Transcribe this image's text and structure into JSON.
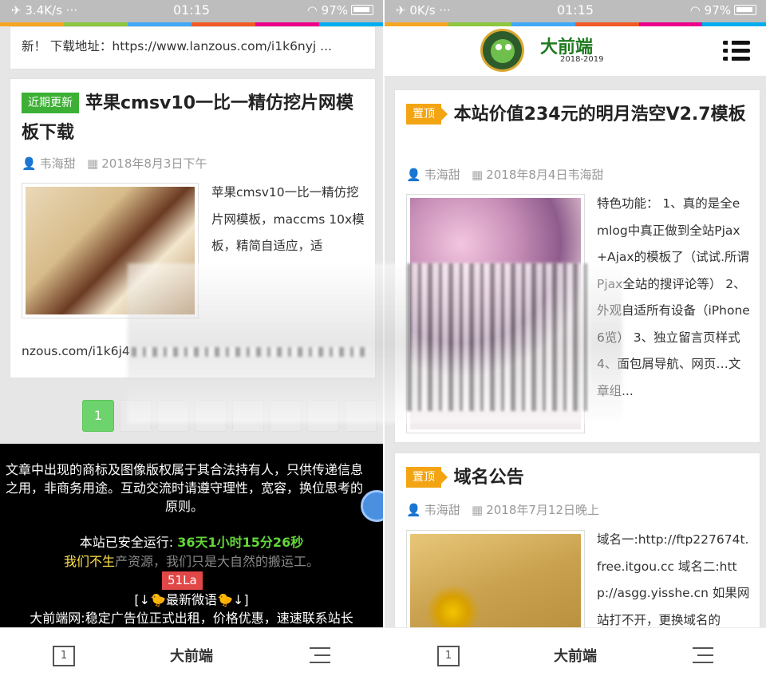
{
  "left": {
    "status": {
      "net": "3.4K/s ···",
      "time": "01:15",
      "battery": "97%"
    },
    "top_card_text": "新！ 下载地址：https://www.lanzous.com/i1k6nyj ...",
    "post": {
      "tag": "近期更新",
      "title": "苹果cmsv10一比一精仿挖片网模板下载",
      "author": "韦海甜",
      "date": "2018年8月3日下午",
      "excerpt": "苹果cmsv10一比一精仿挖片网模板，maccms 10x模板，精简自适应，适",
      "link_fragment": "nzous.com/i1k6j4"
    },
    "pagination": {
      "current": "1"
    },
    "footer": {
      "line1": "文章中出现的商标及图像版权属于其合法持有人，只供传递信息之用，非商务用途。互动交流时请遵守理性，宽容，换位思考的原则。",
      "uptime_label": "本站已安全运行: ",
      "uptime_value": "36天1小时15分26秒",
      "slogan_yellow": "我们不生",
      "slogan_rest": "产资源，我们只是大自然的搬运工。",
      "badge": "51La",
      "weibo": "[↓🐤最新微语🐤↓]",
      "ad": "大前端网:稳定广告位正式出租，价格优惠，速速联系站长"
    },
    "bottom": {
      "tab_count": "1",
      "site_name": "大前端"
    }
  },
  "right": {
    "status": {
      "net": "0K/s ···",
      "time": "01:15",
      "battery": "97%"
    },
    "logo": {
      "name": "大前端",
      "years": "2018-2019"
    },
    "posts": [
      {
        "tag": "置顶",
        "title": "本站价值234元的明月浩空V2.7模板",
        "author": "韦海甜",
        "date": "2018年8月4日韦海甜",
        "excerpt": "特色功能： 1、真的是全emlog中真正做到全站Pjax+Ajax的模板了（试试.所谓Pjax全站的搜评论等） 2、外观自适所有设备（iPhone6览） 3、独立留言页样式 4、面包屑导航、网页…文章组..."
      },
      {
        "tag": "置顶",
        "title": "域名公告",
        "author": "韦海甜",
        "date": "2018年7月12日晚上",
        "excerpt": "域名一:http://ftp227674t.free.itgou.cc 域名二:http://asgg.yisshe.cn 如果网站打不开，更换域名的"
      }
    ],
    "bottom": {
      "tab_count": "1",
      "site_name": "大前端"
    }
  },
  "colors": {
    "rainbow": [
      "#f5a623",
      "#8dc63f",
      "#3fa9f5",
      "#f15a24",
      "#ec008c",
      "#00aeef"
    ],
    "green_tag": "#3cb034",
    "orange_tag": "#f3a412",
    "page_active": "#6dd36c"
  }
}
